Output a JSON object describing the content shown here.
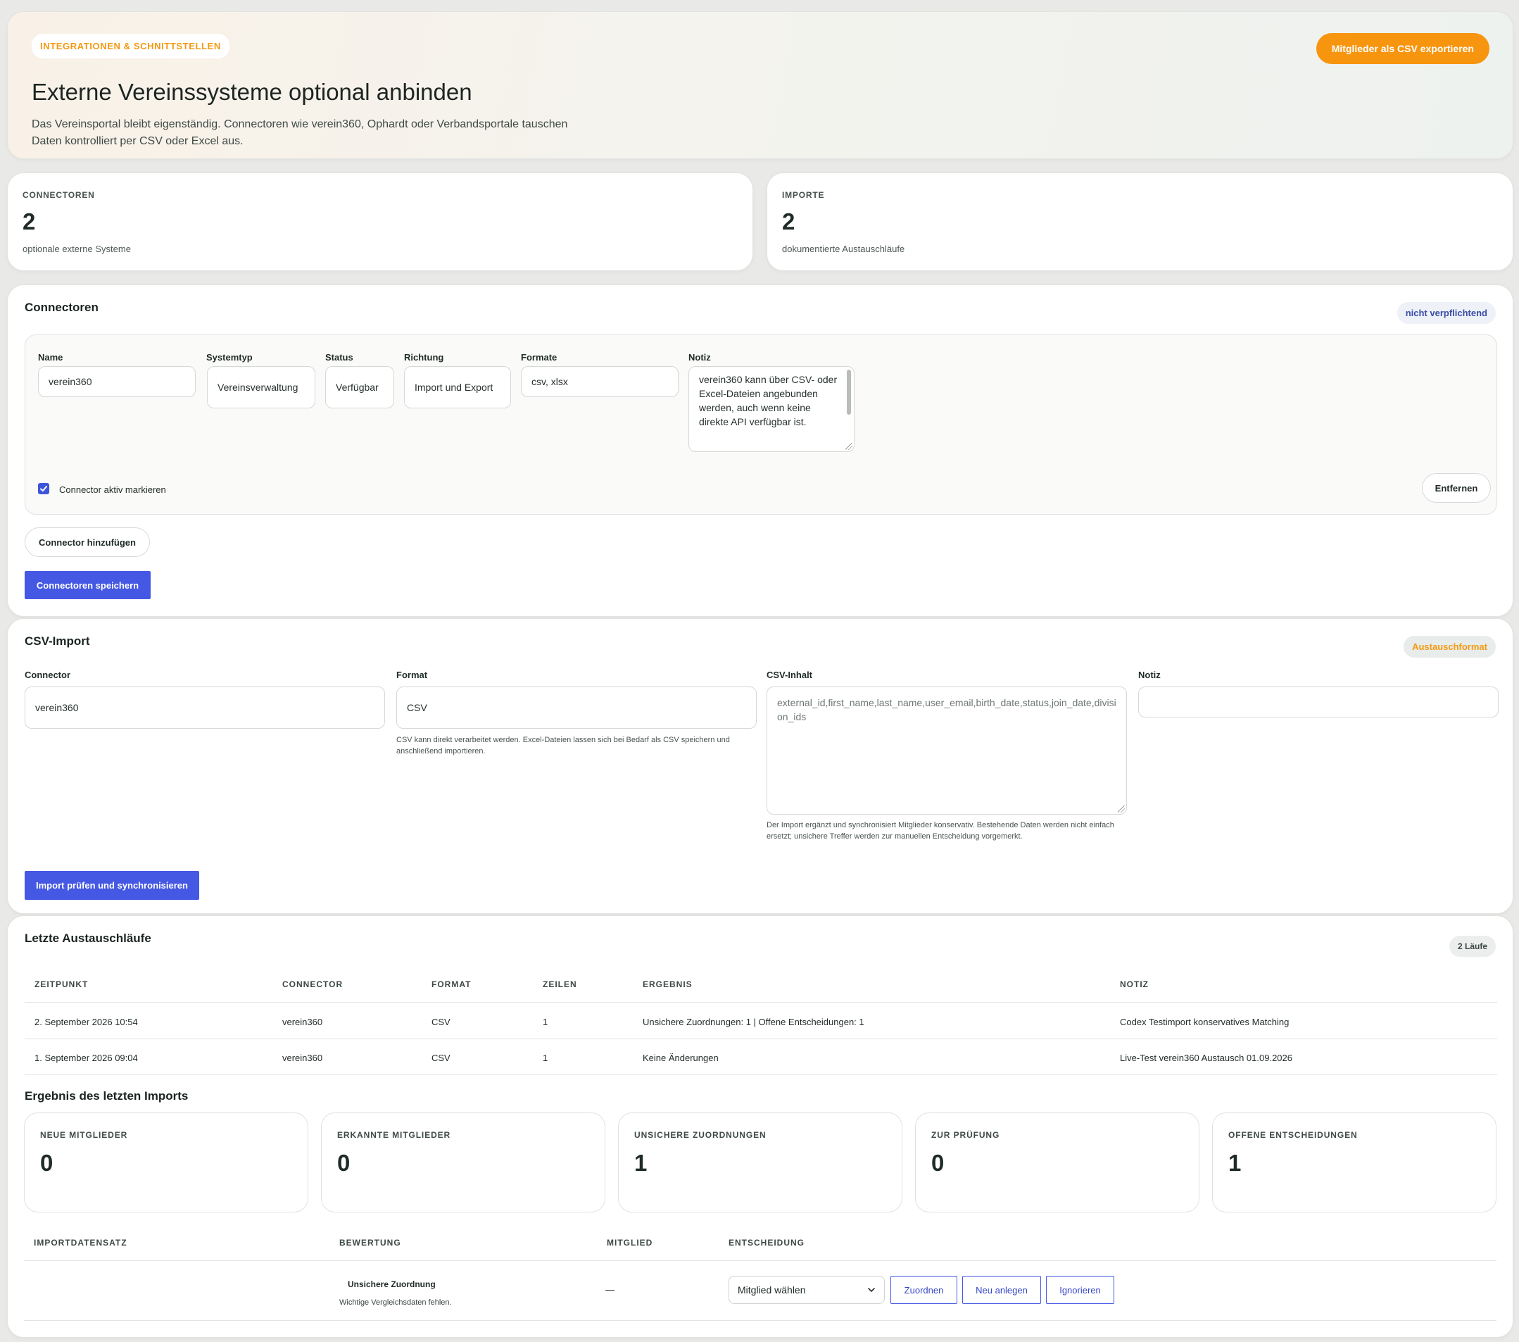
{
  "hero": {
    "eyebrow": "INTEGRATIONEN & SCHNITTSTELLEN",
    "title": "Externe Vereinssysteme optional anbinden",
    "description": "Das Vereinsportal bleibt eigenständig. Connectoren wie verein360, Ophardt oder Verbandsportale tauschen Daten kontrolliert per CSV oder Excel aus.",
    "export_button": "Mitglieder als CSV exportieren"
  },
  "stats": [
    {
      "label": "CONNECTOREN",
      "value": "2",
      "sub": "optionale externe Systeme"
    },
    {
      "label": "IMPORTE",
      "value": "2",
      "sub": "dokumentierte Austauschläufe"
    }
  ],
  "connectors": {
    "title": "Connectoren",
    "badge": "nicht verpflichtend",
    "labels": {
      "name": "Name",
      "systemtyp": "Systemtyp",
      "status": "Status",
      "richtung": "Richtung",
      "formate": "Formate",
      "notiz": "Notiz"
    },
    "item": {
      "name": "verein360",
      "systemtyp": "Vereinsverwaltung",
      "status": "Verfügbar",
      "richtung": "Import und Export",
      "formate": "csv, xlsx",
      "notiz": "verein360 kann über CSV- oder Excel-Dateien angebunden werden, auch wenn keine direkte API verfügbar ist.",
      "active_label": "Connector aktiv markieren",
      "remove_button": "Entfernen"
    },
    "add_button": "Connector hinzufügen",
    "save_button": "Connectoren speichern"
  },
  "csv_import": {
    "title": "CSV-Import",
    "badge": "Austauschformat",
    "labels": {
      "connector": "Connector",
      "format": "Format",
      "content": "CSV-Inhalt",
      "notiz": "Notiz"
    },
    "connector_value": "verein360",
    "format_value": "CSV",
    "format_hint": "CSV kann direkt verarbeitet werden. Excel-Dateien lassen sich bei Bedarf als CSV speichern und anschließend importieren.",
    "content_placeholder": "external_id,first_name,last_name,user_email,birth_date,status,join_date,division_ids",
    "content_hint": "Der Import ergänzt und synchronisiert Mitglieder konservativ. Bestehende Daten werden nicht einfach ersetzt; unsichere Treffer werden zur manuellen Entscheidung vorgemerkt.",
    "notiz_value": "",
    "submit_button": "Import prüfen und synchronisieren"
  },
  "runs": {
    "title": "Letzte Austauschläufe",
    "badge": "2 Läufe",
    "columns": [
      "ZEITPUNKT",
      "CONNECTOR",
      "FORMAT",
      "ZEILEN",
      "ERGEBNIS",
      "NOTIZ"
    ],
    "rows": [
      [
        "2. September 2026 10:54",
        "verein360",
        "CSV",
        "1",
        "Unsichere Zuordnungen: 1 | Offene Entscheidungen: 1",
        "Codex Testimport konservatives Matching"
      ],
      [
        "1. September 2026 09:04",
        "verein360",
        "CSV",
        "1",
        "Keine Änderungen",
        "Live-Test verein360 Austausch 01.09.2026"
      ]
    ]
  },
  "last_import": {
    "title": "Ergebnis des letzten Imports",
    "cards": [
      {
        "label": "NEUE MITGLIEDER",
        "value": "0"
      },
      {
        "label": "ERKANNTE MITGLIEDER",
        "value": "0"
      },
      {
        "label": "UNSICHERE ZUORDNUNGEN",
        "value": "1"
      },
      {
        "label": "ZUR PRÜFUNG",
        "value": "0"
      },
      {
        "label": "OFFENE ENTSCHEIDUNGEN",
        "value": "1"
      }
    ],
    "columns": [
      "IMPORTDATENSATZ",
      "BEWERTUNG",
      "MITGLIED",
      "ENTSCHEIDUNG"
    ],
    "row": {
      "record": "",
      "rating_title": "Unsichere Zuordnung",
      "rating_note": "Wichtige Vergleichsdaten fehlen.",
      "member": "—",
      "select_value": "Mitglied wählen",
      "assign_button": "Zuordnen",
      "create_button": "Neu anlegen",
      "ignore_button": "Ignorieren"
    }
  },
  "colors": {
    "accent_orange": "#f7950f",
    "primary_blue": "#4558e4"
  }
}
